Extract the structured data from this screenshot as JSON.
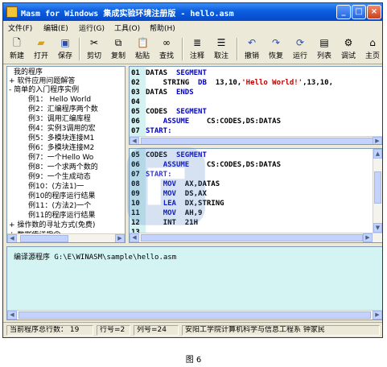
{
  "window": {
    "title": "Masm for Windows 集成实验环境注册版 - hello.asm",
    "accent": "#0a5ee0"
  },
  "caption_buttons": [
    "_",
    "□",
    "×"
  ],
  "menus": [
    "文件(F)",
    "编辑(E)",
    "运行(G)",
    "工具(O)",
    "帮助(H)"
  ],
  "toolbar": [
    {
      "label": "新建",
      "icon": "new-file-icon"
    },
    {
      "label": "打开",
      "icon": "open-folder-icon"
    },
    {
      "label": "保存",
      "icon": "save-icon"
    },
    {
      "label": "剪切",
      "icon": "scissors-icon"
    },
    {
      "label": "复制",
      "icon": "copy-icon"
    },
    {
      "label": "粘贴",
      "icon": "paste-icon"
    },
    {
      "label": "查找",
      "icon": "binoculars-icon"
    },
    {
      "label": "注释",
      "icon": "comment-icon"
    },
    {
      "label": "取注",
      "icon": "uncomment-icon"
    },
    {
      "label": "撤销",
      "icon": "undo-icon"
    },
    {
      "label": "恢复",
      "icon": "redo-icon"
    },
    {
      "label": "运行",
      "icon": "run-icon"
    },
    {
      "label": "列表",
      "icon": "list-icon"
    },
    {
      "label": "调试",
      "icon": "debug-icon"
    },
    {
      "label": "主页",
      "icon": "home-icon"
    }
  ],
  "tree": [
    "我的程序",
    "+ 软件应用问题解答",
    "- 简单的入门程序实例",
    "例1： Hello World",
    "例2：汇编程序两个数",
    "例3：调用汇编库程",
    "例4：实例3调用的宏",
    "例5：多模块连接M1",
    "例6：多模块连接M2",
    "例7：一个Hello Wo",
    "例8：一个求两个数的",
    "例9：一个生成动态",
    "例10：(方法1)一",
    "例10的程序运行结果",
    "例11：(方法2)一个",
    "例11的程序运行结果",
    "+ 操作数的寻址方式(免费)",
    "+ 数据传送指令"
  ],
  "editor_top": [
    {
      "num": "01",
      "parts": [
        {
          "t": "DATAS  ",
          "c": "plain"
        },
        {
          "t": "SEGMENT",
          "c": "kw"
        }
      ]
    },
    {
      "num": "02",
      "parts": [
        {
          "t": "    STRING  ",
          "c": "plain"
        },
        {
          "t": "DB",
          "c": "kw"
        },
        {
          "t": "  13,10,",
          "c": "plain"
        },
        {
          "t": "'Hello World!'",
          "c": "str"
        },
        {
          "t": ",13,10,",
          "c": "plain"
        }
      ]
    },
    {
      "num": "03",
      "parts": [
        {
          "t": "DATAS  ",
          "c": "plain"
        },
        {
          "t": "ENDS",
          "c": "kw"
        }
      ]
    },
    {
      "num": "04",
      "parts": []
    },
    {
      "num": "05",
      "parts": [
        {
          "t": "CODES  ",
          "c": "plain"
        },
        {
          "t": "SEGMENT",
          "c": "kw"
        }
      ]
    },
    {
      "num": "06",
      "parts": [
        {
          "t": "    ",
          "c": "plain"
        },
        {
          "t": "ASSUME",
          "c": "kw"
        },
        {
          "t": "    CS:CODES,DS:DATAS",
          "c": "plain"
        }
      ]
    },
    {
      "num": "07",
      "parts": [
        {
          "t": "START:",
          "c": "kw"
        }
      ]
    }
  ],
  "editor_bottom": [
    {
      "num": "05",
      "parts": [
        {
          "t": "CODES  ",
          "c": "plain"
        },
        {
          "t": "SEGMENT",
          "c": "kw"
        }
      ]
    },
    {
      "num": "06",
      "parts": [
        {
          "t": "    ",
          "c": "plain"
        },
        {
          "t": "ASSUME",
          "c": "kw"
        },
        {
          "t": "    CS:CODES,DS:DATAS",
          "c": "plain"
        }
      ]
    },
    {
      "num": "07",
      "parts": [
        {
          "t": "START:",
          "c": "kw"
        }
      ]
    },
    {
      "num": "08",
      "parts": [
        {
          "t": "    ",
          "c": "plain"
        },
        {
          "t": "MOV",
          "c": "kw"
        },
        {
          "t": "  AX,DATAS",
          "c": "plain"
        }
      ]
    },
    {
      "num": "09",
      "parts": [
        {
          "t": "    ",
          "c": "plain"
        },
        {
          "t": "MOV",
          "c": "kw"
        },
        {
          "t": "  DS,AX",
          "c": "plain"
        }
      ]
    },
    {
      "num": "10",
      "parts": [
        {
          "t": "    ",
          "c": "plain"
        },
        {
          "t": "LEA",
          "c": "kw"
        },
        {
          "t": "  DX,STRING",
          "c": "plain"
        }
      ]
    },
    {
      "num": "11",
      "parts": [
        {
          "t": "    ",
          "c": "plain"
        },
        {
          "t": "MOV",
          "c": "kw"
        },
        {
          "t": "  AH,9",
          "c": "plain"
        }
      ]
    },
    {
      "num": "12",
      "parts": [
        {
          "t": "    INT  21H",
          "c": "plain"
        }
      ]
    },
    {
      "num": "13",
      "parts": []
    }
  ],
  "output": {
    "text": "编译源程序 G:\\E\\WINASM\\sample\\hello.asm"
  },
  "status": {
    "total": "当前程序总行数： 19",
    "row": "行号=2",
    "col": "列号=24",
    "org": "安阳工学院计算机科学与信息工程系   钟家民"
  },
  "figure_caption": "图 6"
}
